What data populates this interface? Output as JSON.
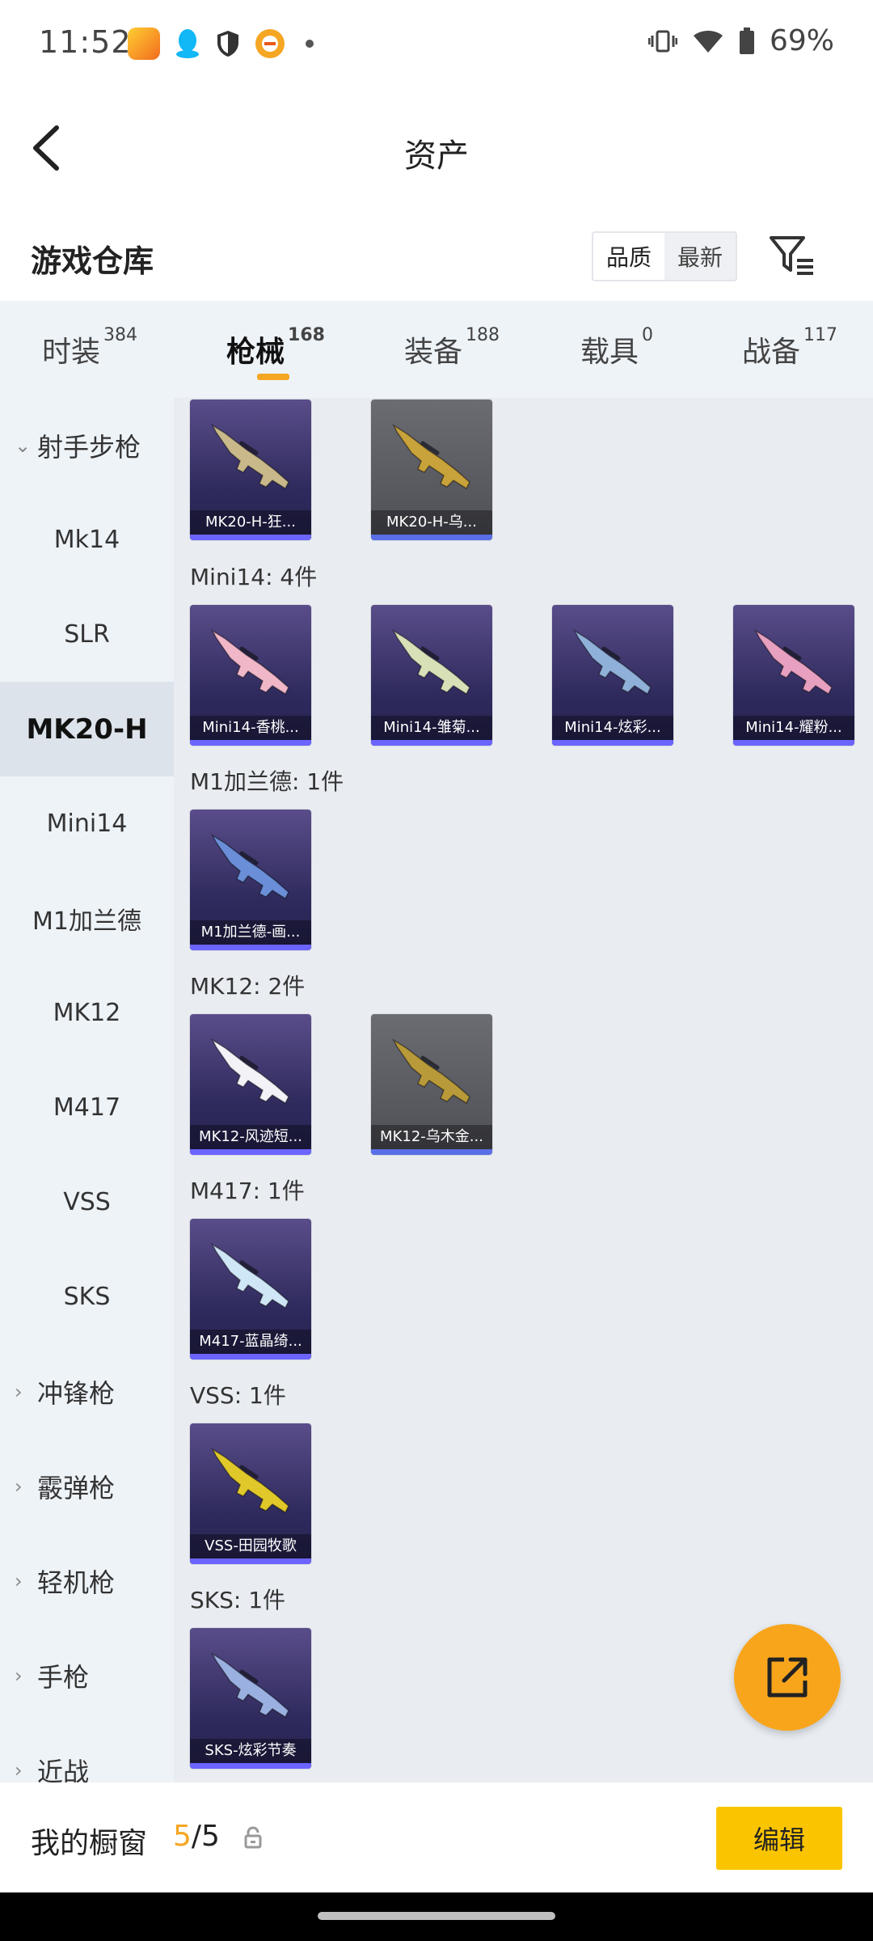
{
  "status_bar": {
    "time": "11:52",
    "battery": "69%",
    "icons_left": [
      "game-app-icon",
      "qq-icon",
      "shield-icon",
      "orange-app-icon",
      "dot-icon"
    ],
    "icons_right": [
      "vibrate-icon",
      "wifi-icon",
      "battery-icon"
    ]
  },
  "header": {
    "title": "资产"
  },
  "section": {
    "title": "游戏仓库",
    "sort_options": [
      "品质",
      "最新"
    ],
    "sort_active": "品质"
  },
  "tabs": [
    {
      "label": "时装",
      "count": "384",
      "active": false
    },
    {
      "label": "枪械",
      "count": "168",
      "active": true
    },
    {
      "label": "装备",
      "count": "188",
      "active": false
    },
    {
      "label": "载具",
      "count": "0",
      "active": false
    },
    {
      "label": "战备",
      "count": "117",
      "active": false
    }
  ],
  "sidebar": {
    "expanded_category": "射手步枪",
    "items": [
      "Mk14",
      "SLR",
      "MK20-H",
      "Mini14",
      "M1加兰德",
      "MK12",
      "M417",
      "VSS",
      "SKS"
    ],
    "active_item": "MK20-H",
    "collapsed_categories": [
      "冲锋枪",
      "霰弹枪",
      "轻机枪",
      "手枪",
      "近战"
    ]
  },
  "groups": [
    {
      "title": "",
      "cards": [
        {
          "label": "MK20-H-狂...",
          "style": "purple",
          "gun_color": "#c9b98a"
        },
        {
          "label": "MK20-H-乌...",
          "style": "gray",
          "gun_color": "#c8a23a"
        }
      ]
    },
    {
      "title": "Mini14: 4件",
      "cards": [
        {
          "label": "Mini14-香桃...",
          "style": "purple",
          "gun_color": "#f0b7c8"
        },
        {
          "label": "Mini14-雏菊...",
          "style": "purple",
          "gun_color": "#d8e0b8"
        },
        {
          "label": "Mini14-炫彩...",
          "style": "purple",
          "gun_color": "#8fb0d8"
        },
        {
          "label": "Mini14-耀粉...",
          "style": "purple",
          "gun_color": "#e8a0c0"
        }
      ]
    },
    {
      "title": "M1加兰德: 1件",
      "cards": [
        {
          "label": "M1加兰德-画...",
          "style": "purple",
          "gun_color": "#6a8fd8"
        }
      ]
    },
    {
      "title": "MK12: 2件",
      "cards": [
        {
          "label": "MK12-风迹短...",
          "style": "purple",
          "gun_color": "#f2f2f7"
        },
        {
          "label": "MK12-乌木金...",
          "style": "gray",
          "gun_color": "#b89a3a"
        }
      ]
    },
    {
      "title": "M417: 1件",
      "cards": [
        {
          "label": "M417-蓝晶绮...",
          "style": "purple",
          "gun_color": "#cfe6f7"
        }
      ]
    },
    {
      "title": "VSS: 1件",
      "cards": [
        {
          "label": "VSS-田园牧歌",
          "style": "purple",
          "gun_color": "#e0c82a"
        }
      ]
    },
    {
      "title": "SKS: 1件",
      "cards": [
        {
          "label": "SKS-炫彩节奏",
          "style": "purple",
          "gun_color": "#9ab0e0"
        }
      ]
    }
  ],
  "bottom_bar": {
    "label": "我的橱窗",
    "current": "5",
    "total": "/5",
    "edit_label": "编辑"
  },
  "colors": {
    "accent": "#f5a623",
    "edit_button": "#fbc400",
    "card_purple": "#2e2a5c",
    "card_gray": "#55565c"
  }
}
